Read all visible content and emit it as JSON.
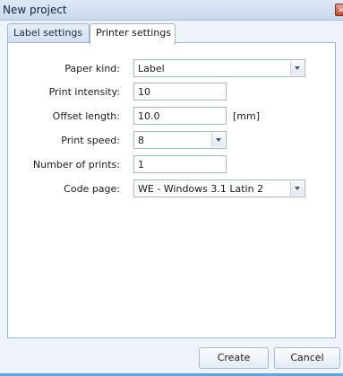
{
  "window": {
    "title": "New project",
    "close_glyph": "×"
  },
  "tabs": [
    {
      "label": "Label settings",
      "active": false
    },
    {
      "label": "Printer settings",
      "active": true
    }
  ],
  "form": {
    "paper_kind": {
      "label": "Paper kind:",
      "value": "Label"
    },
    "print_intensity": {
      "label": "Print intensity:",
      "value": "10"
    },
    "offset_length": {
      "label": "Offset length:",
      "value": "10.0",
      "unit": "[mm]"
    },
    "print_speed": {
      "label": "Print speed:",
      "value": "8"
    },
    "number_of_prints": {
      "label": "Number of prints:",
      "value": "1"
    },
    "code_page": {
      "label": "Code page:",
      "value": "WE - Windows 3.1 Latin 2"
    }
  },
  "buttons": {
    "create": "Create",
    "cancel": "Cancel"
  },
  "icons": {
    "close": "close-icon",
    "dropdown": "chevron-down-icon"
  },
  "colors": {
    "accent": "#5aa8e0",
    "border": "#9fb5cf",
    "background": "#eef3fa"
  }
}
